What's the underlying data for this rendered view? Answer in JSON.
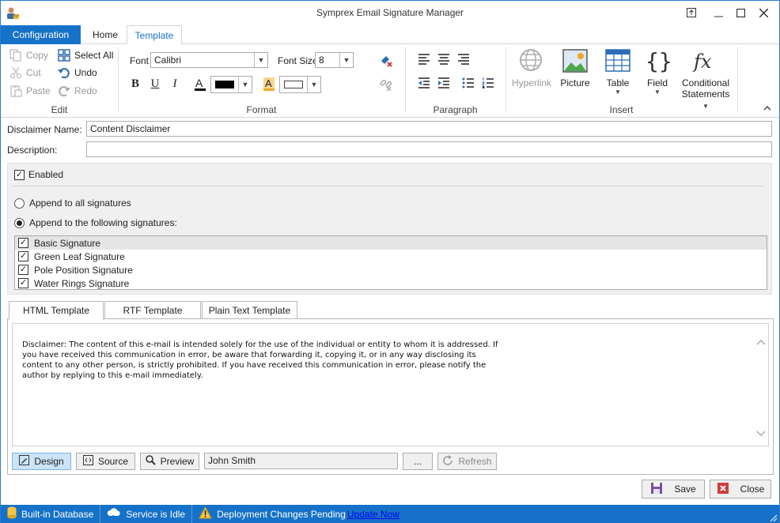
{
  "window": {
    "title": "Symprex Email Signature Manager"
  },
  "ribbon_tabs": {
    "configuration": "Configuration",
    "home": "Home",
    "template": "Template"
  },
  "edit": {
    "copy": "Copy",
    "cut": "Cut",
    "paste": "Paste",
    "select_all": "Select All",
    "undo": "Undo",
    "redo": "Redo",
    "label": "Edit"
  },
  "format": {
    "font_label": "Font",
    "font_value": "Calibri",
    "size_label": "Font Size",
    "size_value": "8",
    "bold": "B",
    "underline": "U",
    "italic": "I",
    "label": "Format"
  },
  "paragraph": {
    "label": "Paragraph"
  },
  "insert": {
    "hyperlink": "Hyperlink",
    "picture": "Picture",
    "table": "Table",
    "field": "Field",
    "conditional": "Conditional",
    "statements": "Statements",
    "label": "Insert"
  },
  "form": {
    "disclaimer_name_label": "Disclaimer Name:",
    "disclaimer_name_value": "Content Disclaimer",
    "description_label": "Description:",
    "description_value": "",
    "enabled_label": "Enabled",
    "append_all_label": "Append to all signatures",
    "append_following_label": "Append to the following signatures:",
    "signatures": [
      {
        "name": "Basic Signature",
        "checked": true
      },
      {
        "name": "Green Leaf Signature",
        "checked": true
      },
      {
        "name": "Pole Position Signature",
        "checked": true
      },
      {
        "name": "Water Rings Signature",
        "checked": true
      }
    ]
  },
  "template_tabs": {
    "html": "HTML Template",
    "rtf": "RTF Template",
    "plain": "Plain Text Template"
  },
  "editor": {
    "text": "Disclaimer: The content of this e-mail is intended solely for the use of the individual or entity to whom it is addressed. If you have received this communication in error, be aware that forwarding it, copying it, or in any way disclosing its content to any other person, is strictly prohibited. If you have received this communication in error, please notify the author by replying to this e-mail immediately."
  },
  "bottom": {
    "design": "Design",
    "source": "Source",
    "preview": "Preview",
    "user_value": "John Smith",
    "ellipsis": "...",
    "refresh": "Refresh"
  },
  "actions": {
    "save": "Save",
    "close": "Close"
  },
  "status": {
    "database": "Built-in Database",
    "service": "Service is Idle",
    "pending": "Deployment Changes Pending",
    "update_link": "Update Now"
  },
  "colors": {
    "accent": "#1672c8",
    "status_bar": "#1672c8"
  }
}
